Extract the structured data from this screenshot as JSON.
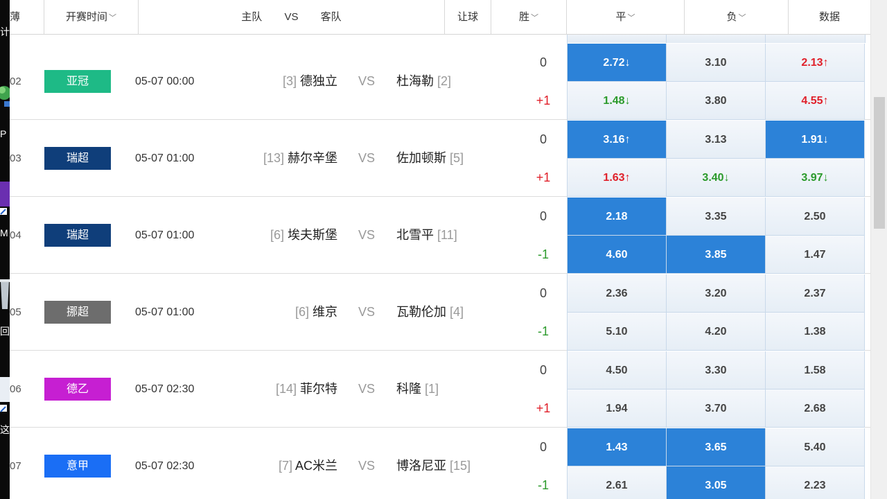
{
  "header": {
    "start_time": "开赛时间",
    "home_label": "主队",
    "vs_label": "VS",
    "away_label": "客队",
    "handicap": "让球",
    "win": "胜",
    "draw": "平",
    "loss": "负",
    "data": "数据",
    "partial_left": "薄"
  },
  "desktop": {
    "labels": [
      "计",
      "回",
      "M",
      "回",
      "这"
    ]
  },
  "colors": {
    "highlight": "#2c82d8",
    "up": "#e0202a",
    "down": "#2b9a2b"
  },
  "matches": [
    {
      "num": "02",
      "league": "亚冠",
      "league_color": "#1eba86",
      "time": "05-07 00:00",
      "home_rank": "[3]",
      "home": "德独立",
      "vs": "VS",
      "away": "杜海勒",
      "away_rank": "[2]",
      "lines": [
        {
          "hcp": "0",
          "kind": "zero",
          "odds": [
            {
              "v": "2.72",
              "a": "↓",
              "hl": true,
              "t": "down"
            },
            {
              "v": "3.10",
              "a": "",
              "hl": false,
              "t": ""
            },
            {
              "v": "2.13",
              "a": "↑",
              "hl": false,
              "t": "up"
            }
          ]
        },
        {
          "hcp": "+1",
          "kind": "plus",
          "odds": [
            {
              "v": "1.48",
              "a": "↓",
              "hl": false,
              "t": "down"
            },
            {
              "v": "3.80",
              "a": "",
              "hl": false,
              "t": ""
            },
            {
              "v": "4.55",
              "a": "↑",
              "hl": false,
              "t": "up"
            }
          ]
        }
      ]
    },
    {
      "num": "03",
      "league": "瑞超",
      "league_color": "#0f3e7a",
      "time": "05-07 01:00",
      "home_rank": "[13]",
      "home": "赫尔辛堡",
      "vs": "VS",
      "away": "佐加顿斯",
      "away_rank": "[5]",
      "lines": [
        {
          "hcp": "0",
          "kind": "zero",
          "odds": [
            {
              "v": "3.16",
              "a": "↑",
              "hl": true,
              "t": "up"
            },
            {
              "v": "3.13",
              "a": "",
              "hl": false,
              "t": ""
            },
            {
              "v": "1.91",
              "a": "↓",
              "hl": true,
              "t": "down"
            }
          ]
        },
        {
          "hcp": "+1",
          "kind": "plus",
          "odds": [
            {
              "v": "1.63",
              "a": "↑",
              "hl": false,
              "t": "up"
            },
            {
              "v": "3.40",
              "a": "↓",
              "hl": false,
              "t": "down"
            },
            {
              "v": "3.97",
              "a": "↓",
              "hl": false,
              "t": "down"
            }
          ]
        }
      ]
    },
    {
      "num": "04",
      "league": "瑞超",
      "league_color": "#0f3e7a",
      "time": "05-07 01:00",
      "home_rank": "[6]",
      "home": "埃夫斯堡",
      "vs": "VS",
      "away": "北雪平",
      "away_rank": "[11]",
      "lines": [
        {
          "hcp": "0",
          "kind": "zero",
          "odds": [
            {
              "v": "2.18",
              "a": "",
              "hl": true,
              "t": ""
            },
            {
              "v": "3.35",
              "a": "",
              "hl": false,
              "t": ""
            },
            {
              "v": "2.50",
              "a": "",
              "hl": false,
              "t": ""
            }
          ]
        },
        {
          "hcp": "-1",
          "kind": "minus",
          "odds": [
            {
              "v": "4.60",
              "a": "",
              "hl": true,
              "t": ""
            },
            {
              "v": "3.85",
              "a": "",
              "hl": true,
              "t": ""
            },
            {
              "v": "1.47",
              "a": "",
              "hl": false,
              "t": ""
            }
          ]
        }
      ]
    },
    {
      "num": "05",
      "league": "挪超",
      "league_color": "#6d6d6d",
      "time": "05-07 01:00",
      "home_rank": "[6]",
      "home": "维京",
      "vs": "VS",
      "away": "瓦勒伦加",
      "away_rank": "[4]",
      "lines": [
        {
          "hcp": "0",
          "kind": "zero",
          "odds": [
            {
              "v": "2.36",
              "a": "",
              "hl": false,
              "t": ""
            },
            {
              "v": "3.20",
              "a": "",
              "hl": false,
              "t": ""
            },
            {
              "v": "2.37",
              "a": "",
              "hl": false,
              "t": ""
            }
          ]
        },
        {
          "hcp": "-1",
          "kind": "minus",
          "odds": [
            {
              "v": "5.10",
              "a": "",
              "hl": false,
              "t": ""
            },
            {
              "v": "4.20",
              "a": "",
              "hl": false,
              "t": ""
            },
            {
              "v": "1.38",
              "a": "",
              "hl": false,
              "t": ""
            }
          ]
        }
      ]
    },
    {
      "num": "06",
      "league": "德乙",
      "league_color": "#c61fd2",
      "time": "05-07 02:30",
      "home_rank": "[14]",
      "home": "菲尔特",
      "vs": "VS",
      "away": "科隆",
      "away_rank": "[1]",
      "lines": [
        {
          "hcp": "0",
          "kind": "zero",
          "odds": [
            {
              "v": "4.50",
              "a": "",
              "hl": false,
              "t": ""
            },
            {
              "v": "3.30",
              "a": "",
              "hl": false,
              "t": ""
            },
            {
              "v": "1.58",
              "a": "",
              "hl": false,
              "t": ""
            }
          ]
        },
        {
          "hcp": "+1",
          "kind": "plus",
          "odds": [
            {
              "v": "1.94",
              "a": "",
              "hl": false,
              "t": ""
            },
            {
              "v": "3.70",
              "a": "",
              "hl": false,
              "t": ""
            },
            {
              "v": "2.68",
              "a": "",
              "hl": false,
              "t": ""
            }
          ]
        }
      ]
    },
    {
      "num": "07",
      "league": "意甲",
      "league_color": "#1a6ef5",
      "time": "05-07 02:30",
      "home_rank": "[7]",
      "home": "AC米兰",
      "vs": "VS",
      "away": "博洛尼亚",
      "away_rank": "[15]",
      "lines": [
        {
          "hcp": "0",
          "kind": "zero",
          "odds": [
            {
              "v": "1.43",
              "a": "",
              "hl": true,
              "t": ""
            },
            {
              "v": "3.65",
              "a": "",
              "hl": true,
              "t": ""
            },
            {
              "v": "5.40",
              "a": "",
              "hl": false,
              "t": ""
            }
          ]
        },
        {
          "hcp": "-1",
          "kind": "minus",
          "odds": [
            {
              "v": "2.61",
              "a": "",
              "hl": false,
              "t": ""
            },
            {
              "v": "3.05",
              "a": "",
              "hl": true,
              "t": ""
            },
            {
              "v": "2.23",
              "a": "",
              "hl": false,
              "t": ""
            }
          ]
        }
      ]
    }
  ]
}
